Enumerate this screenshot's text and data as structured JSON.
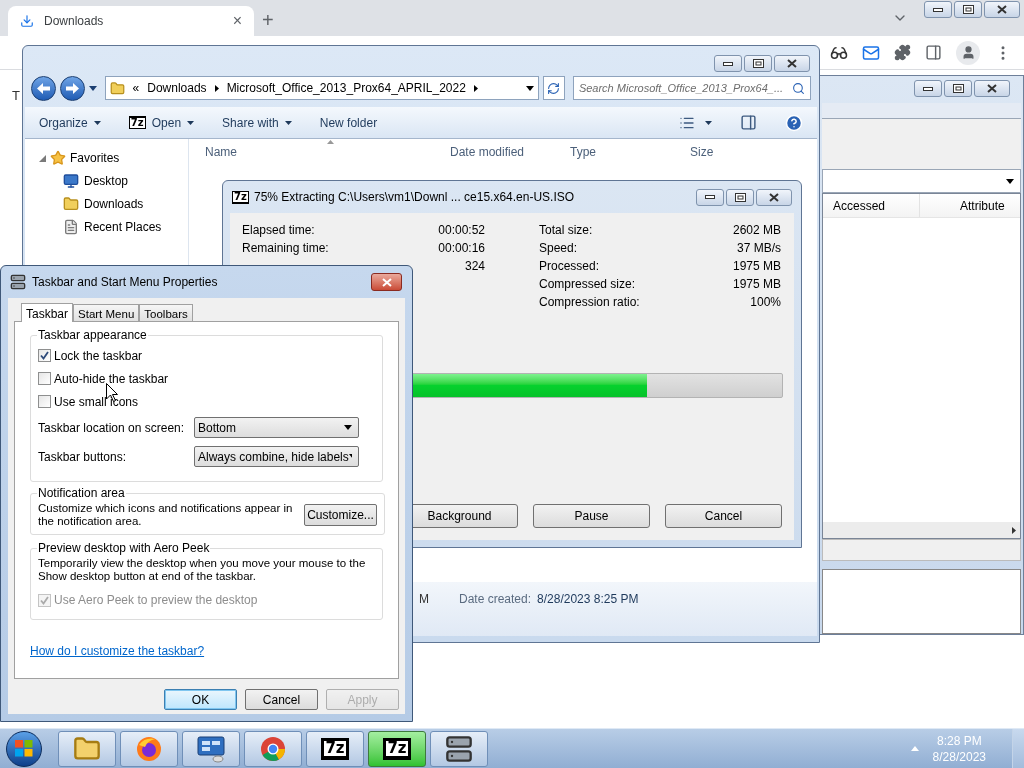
{
  "browser": {
    "tab": {
      "title": "Downloads",
      "close": "×"
    },
    "new_tab": "+",
    "page_text": "T"
  },
  "bg_window": {
    "columns": [
      "Accessed",
      "Attribute"
    ]
  },
  "explorer": {
    "breadcrumb_lead": "«",
    "breadcrumb": [
      "Downloads",
      "Microsoft_Office_2013_Prox64_APRIL_2022"
    ],
    "search": {
      "placeholder": "Search Microsoft_Office_2013_Prox64_..."
    },
    "toolbar": [
      {
        "label": "Organize",
        "kind": "menu"
      },
      {
        "label": "Open",
        "kind": "menu",
        "icon_text": "7z"
      },
      {
        "label": "Share with",
        "kind": "menu"
      },
      {
        "label": "New folder",
        "kind": "plain"
      }
    ],
    "favorites": {
      "label": "Favorites",
      "expanded": true,
      "children": [
        {
          "label": "Desktop",
          "kind": "desktop"
        },
        {
          "label": "Downloads",
          "kind": "downloads"
        },
        {
          "label": "Recent Places",
          "kind": "recent"
        }
      ]
    },
    "columns": [
      "Name",
      "Date modified",
      "Type",
      "Size"
    ],
    "details": {
      "partial": "M",
      "label": "Date created:",
      "value": "8/28/2023 8:25 PM"
    }
  },
  "extract": {
    "icon_text": "7z",
    "title": "75% Extracting C:\\Users\\vm1\\Downl ... ce15.x64.en-US.ISO",
    "left": [
      {
        "label": "Elapsed time:",
        "value": "00:00:52"
      },
      {
        "label": "Remaining time:",
        "value": "00:00:16"
      },
      {
        "value": "324"
      }
    ],
    "right": [
      {
        "label": "Total size:",
        "value": "2602 MB"
      },
      {
        "label": "Speed:",
        "value": "37 MB/s"
      },
      {
        "label": "Processed:",
        "value": "1975 MB"
      },
      {
        "label": "Compressed size:",
        "value": "1975 MB"
      },
      {
        "label": "Compression ratio:",
        "value": "100%"
      }
    ],
    "progress": {
      "level": 0.75
    },
    "buttons": [
      "Background",
      "Pause",
      "Cancel"
    ]
  },
  "props": {
    "title": "Taskbar and Start Menu Properties",
    "tabs": [
      {
        "label": "Taskbar",
        "selected": true
      },
      {
        "label": "Start Menu",
        "selected": false
      },
      {
        "label": "Toolbars",
        "selected": false
      }
    ],
    "appearance": {
      "heading": "Taskbar appearance",
      "options": [
        {
          "label": "Lock the taskbar",
          "checked": true,
          "disabled": false
        },
        {
          "label": "Auto-hide the taskbar",
          "checked": false,
          "disabled": false
        },
        {
          "label": "Use small icons",
          "checked": false,
          "disabled": false
        }
      ],
      "selects": [
        {
          "label": "Taskbar location on screen:",
          "value": "Bottom"
        },
        {
          "label": "Taskbar buttons:",
          "value": "Always combine, hide labels"
        }
      ]
    },
    "notification": {
      "heading": "Notification area",
      "text": "Customize which icons and notifications appear in the notification area.",
      "button": "Customize..."
    },
    "peek": {
      "heading": "Preview desktop with Aero Peek",
      "text": "Temporarily view the desktop when you move your mouse to the Show desktop button at end of the taskbar.",
      "option": {
        "label": "Use Aero Peek to preview the desktop",
        "checked": true,
        "disabled": true
      }
    },
    "help_link": "How do I customize the taskbar?",
    "buttons": [
      {
        "label": "OK",
        "kind": "default",
        "disabled": false
      },
      {
        "label": "Cancel",
        "kind": "normal",
        "disabled": false
      },
      {
        "label": "Apply",
        "kind": "normal",
        "disabled": true
      }
    ]
  },
  "taskbar": {
    "buttons": [
      {
        "kind": "explorer",
        "selected": false
      },
      {
        "kind": "firefox",
        "selected": false
      },
      {
        "kind": "control",
        "selected": false
      },
      {
        "kind": "chrome",
        "selected": false
      },
      {
        "kind": "sevenzip",
        "icon_text": "7z",
        "selected": false
      },
      {
        "kind": "sevenzip",
        "icon_text": "7z",
        "selected": true
      },
      {
        "kind": "server",
        "selected": false
      }
    ],
    "clock": {
      "time": "8:28 PM",
      "date": "8/28/2023"
    }
  }
}
